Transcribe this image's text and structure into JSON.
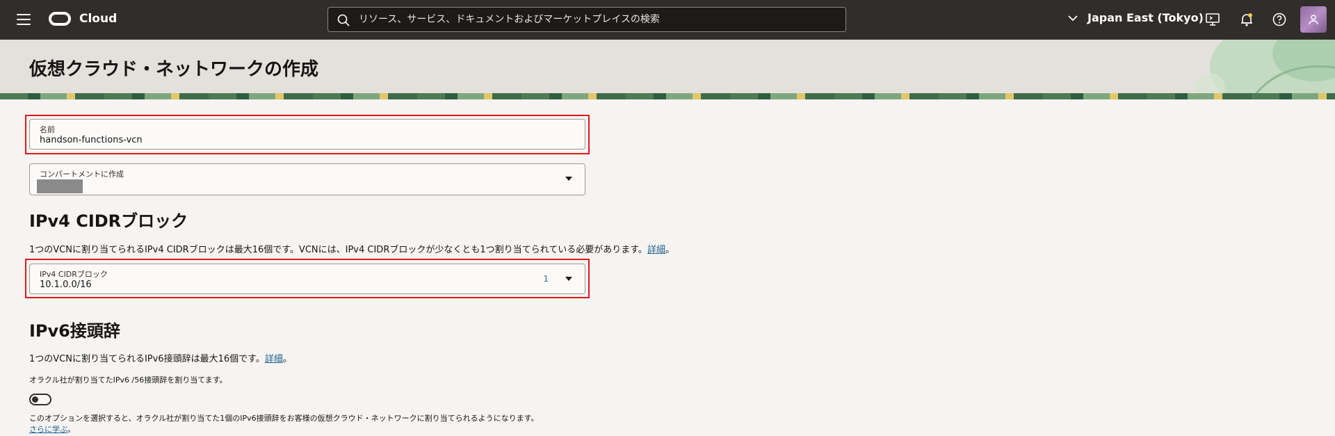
{
  "header": {
    "brand": "Cloud",
    "search_placeholder": "リソース、サービス、ドキュメントおよびマーケットプレイスの検索",
    "region": "Japan East (Tokyo)"
  },
  "page": {
    "title": "仮想クラウド・ネットワークの作成"
  },
  "form": {
    "name": {
      "label": "名前",
      "value": "handson-functions-vcn"
    },
    "compartment": {
      "label": "コンパートメントに作成"
    },
    "ipv4": {
      "title": "IPv4 CIDRブロック",
      "desc": "1つのVCNに割り当てられるIPv4 CIDRブロックは最大16個です。VCNには、IPv4 CIDRブロックが少なくとも1つ割り当てられている必要があります。",
      "desc_link": "詳細",
      "desc_end": "。",
      "field_label": "IPv4 CIDRブロック",
      "field_value": "10.1.0.0/16",
      "count": "1"
    },
    "ipv6": {
      "title": "IPv6接頭辞",
      "desc": "1つのVCNに割り当てられるIPv6接頭辞は最大16個です。",
      "desc_link": "詳細",
      "desc_end": "。",
      "toggle_label": "オラクル社が割り当てたIPv6 /56接頭辞を割り当てます。",
      "toggle_help": "このオプションを選択すると、オラクル社が割り当てた1個のIPv6接頭辞をお客様の仮想クラウド・ネットワークに割り当てられるようになります。",
      "learn_more": "さらに学ぶ",
      "learn_more_end": "。"
    }
  },
  "colors": {
    "topbar": "#312d2a",
    "highlight": "#e3161b",
    "link": "#1f5e8c"
  }
}
